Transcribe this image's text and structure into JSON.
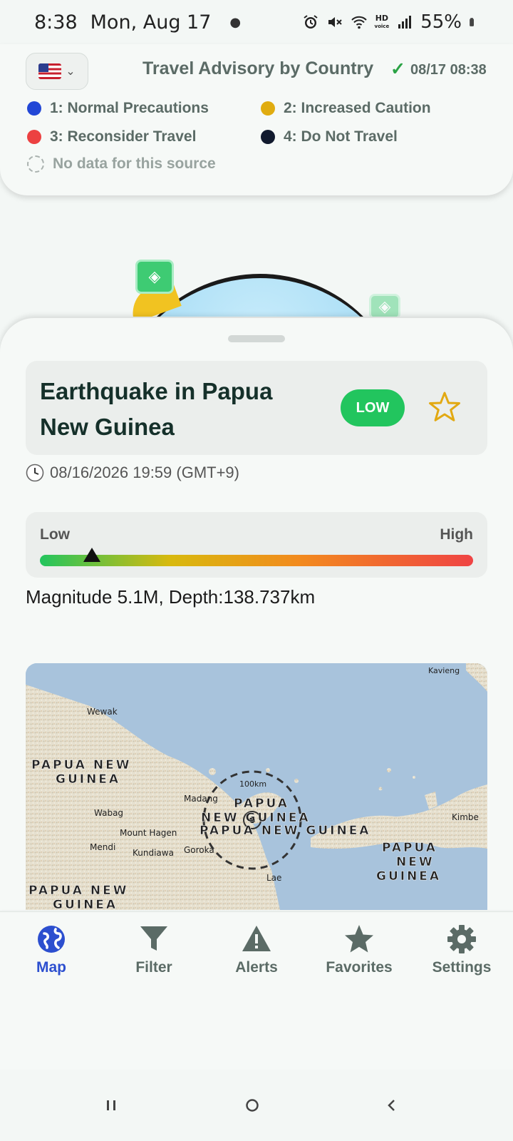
{
  "status_bar": {
    "time": "8:38",
    "date": "Mon, Aug 17",
    "battery": "55%",
    "icons": [
      "alarm-icon",
      "mute-icon",
      "wifi-icon",
      "hd-voice-icon",
      "signal-icon",
      "battery-icon"
    ],
    "hd_label": "HD",
    "hd_sub": "voice"
  },
  "header": {
    "country_flag": "us-flag-icon",
    "title": "Travel Advisory by Country",
    "updated": "08/17 08:38",
    "legend": [
      {
        "label": "1: Normal Precautions",
        "color": "#2247d6"
      },
      {
        "label": "2: Increased Caution",
        "color": "#e0ac10"
      },
      {
        "label": "3: Reconsider Travel",
        "color": "#ec4141"
      },
      {
        "label": "4: Do Not Travel",
        "color": "#111a2e"
      },
      {
        "label": "No data for this source",
        "color": "none"
      }
    ]
  },
  "event": {
    "title": "Earthquake in Papua New Guinea",
    "severity": "LOW",
    "severity_color": "#22c55e",
    "datetime": "08/16/2026 19:59 (GMT+9)",
    "risk_low_label": "Low",
    "risk_high_label": "High",
    "risk_level": 0.12,
    "details": "Magnitude 5.1M, Depth:138.737km"
  },
  "event_map": {
    "scale_label": "100km",
    "labels": {
      "kavieng": "Kavieng",
      "wewak": "Wewak",
      "png_1a": "PAPUA NEW",
      "png_1b": "GUINEA",
      "madang": "Madang",
      "wabag": "Wabag",
      "mount_hagen": "Mount Hagen",
      "mendi": "Mendi",
      "kundiawa": "Kundiawa",
      "goroka": "Goroka",
      "lae": "Lae",
      "kimbe": "Kimbe",
      "png_c1": "PAPUA",
      "png_c2": "NEW GUINEA",
      "png_c3": "PAPUA NEW GUINEA",
      "png_r1": "PAPUA",
      "png_r2": "NEW",
      "png_r3": "GUINEA",
      "png_bl1": "PAPUA NEW",
      "png_bl2": "GUINEA"
    }
  },
  "nav": {
    "items": [
      {
        "label": "Map",
        "icon": "globe-icon",
        "active": true
      },
      {
        "label": "Filter",
        "icon": "filter-icon",
        "active": false
      },
      {
        "label": "Alerts",
        "icon": "warning-icon",
        "active": false
      },
      {
        "label": "Favorites",
        "icon": "star-icon",
        "active": false
      },
      {
        "label": "Settings",
        "icon": "gear-icon",
        "active": false
      }
    ]
  },
  "system_nav": {
    "recents": "recents-icon",
    "home": "home-icon",
    "back": "back-icon"
  }
}
